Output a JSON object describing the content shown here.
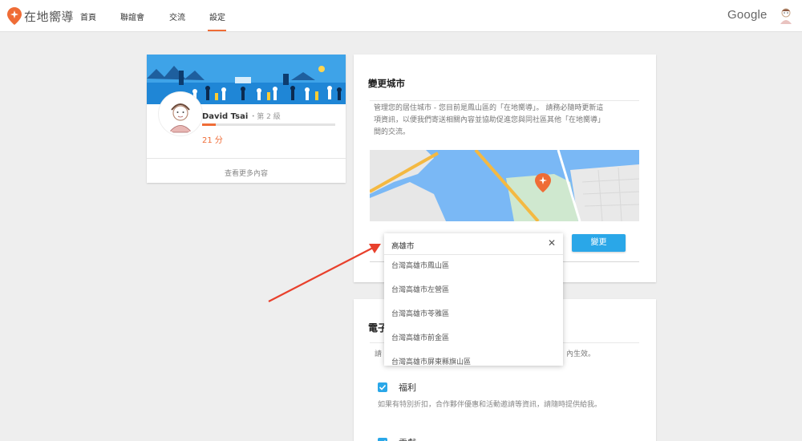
{
  "brand": {
    "name": "在地嚮導"
  },
  "nav": {
    "items": [
      {
        "label": "首頁"
      },
      {
        "label": "聯誼會"
      },
      {
        "label": "交流"
      },
      {
        "label": "設定"
      }
    ],
    "active_index": 3
  },
  "header": {
    "google_logo": "Google"
  },
  "profile": {
    "name": "David Tsai",
    "level": "・第 2 級",
    "points": "21 分",
    "progress": 0.1,
    "more_link": "查看更多內容"
  },
  "city": {
    "title": "變更城市",
    "description": "管理您的居住城市 - 您目前是鳳山區的「在地嚮導」。 請務必隨時更新這項資訊，以便我們寄送相關內容並協助促進您與同社區其他「在地嚮導」間的交流。",
    "change_button": "變更"
  },
  "dropdown": {
    "input_value": "高雄市",
    "clear_icon": "close-icon",
    "options": [
      "台灣高雄市鳳山區",
      "台灣高雄市左營區",
      "台灣高雄市苓雅區",
      "台灣高雄市前金區",
      "台灣高雄市屏東縣旗山區"
    ]
  },
  "email": {
    "title_fragment": "電子",
    "desc_left": "請",
    "desc_right": "內生效。",
    "options": [
      {
        "label": "福利",
        "checked": true,
        "description": "如果有特別折扣，合作夥伴優惠和活動邀請等資訊，請隨時提供給我。"
      },
      {
        "label": "貢獻",
        "checked": true
      }
    ]
  },
  "colors": {
    "accent_orange": "#ef6c36",
    "button_blue": "#2aa7e8",
    "annotation_red": "#e8402c"
  }
}
